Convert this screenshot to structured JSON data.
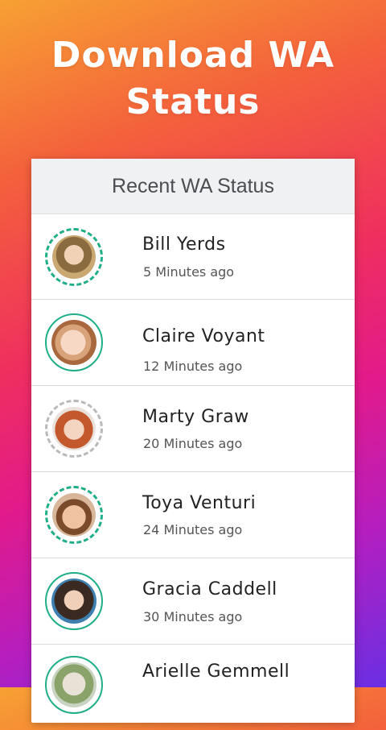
{
  "headline": {
    "line1": "Download WA",
    "line2": "Status"
  },
  "card": {
    "title": "Recent WA Status"
  },
  "accent_color": "#1fae87",
  "seen_color": "#b9b9b9",
  "statuses": [
    {
      "name": "Bill Yerds",
      "time": "5 Minutes ago",
      "ring": "dashed-green"
    },
    {
      "name": "Claire Voyant",
      "time": "12 Minutes ago",
      "ring": "solid-green"
    },
    {
      "name": "Marty Graw",
      "time": "20 Minutes ago",
      "ring": "dashed-gray"
    },
    {
      "name": "Toya Venturi",
      "time": "24 Minutes ago",
      "ring": "dashed-green"
    },
    {
      "name": "Gracia Caddell",
      "time": "30 Minutes ago",
      "ring": "solid-green"
    },
    {
      "name": "Arielle Gemmell",
      "time": "",
      "ring": "solid-green"
    }
  ]
}
